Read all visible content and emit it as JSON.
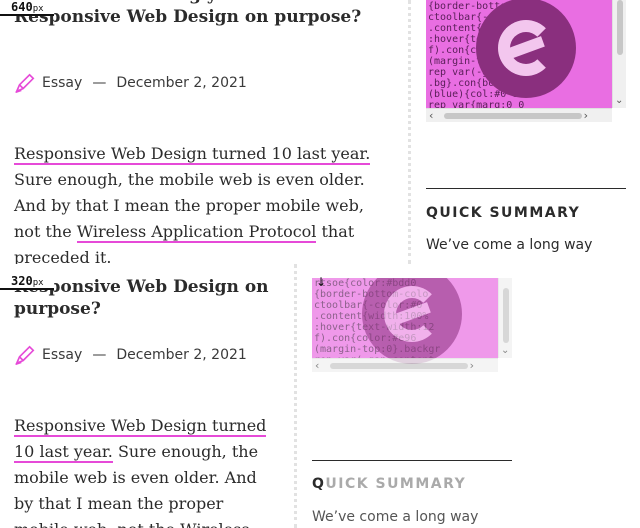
{
  "panels": {
    "wide": {
      "width_value": "640",
      "width_unit": "px",
      "article": {
        "title": "How about undoing years of Responsive Web Design on purpose?",
        "category": "Essay",
        "separator": "—",
        "date": "December 2, 2021",
        "link1": "Responsive Web Design turned 10 last year.",
        "text1": " Sure enough, the mobile web is even older. And by that I mean the proper mobile web, not the ",
        "link2": "Wireless Application Protocol",
        "text2": " that preceded it."
      },
      "sidebar": {
        "heading": "QUICK SUMMARY",
        "text": "We’ve come a long way"
      }
    },
    "narrow": {
      "width_value": "320",
      "width_unit": "px",
      "article": {
        "title": "Responsive Web Design on purpose?",
        "category": "Essay",
        "separator": "—",
        "date": "December 2, 2021",
        "link1": "Responsive Web Design turned 10 last year.",
        "text1": " Sure enough, the mobile web is even older. And by that I mean the proper mobile web, not the Wireless",
        "link2": "",
        "text2": ""
      },
      "sidebar": {
        "heading_first": "Q",
        "heading_rest": "UICK SUMMARY",
        "text": "We’ve come a long way"
      }
    }
  },
  "thumbnail": {
    "icon": "smashing-logo-icon",
    "code_text": "rtsoe{color:#bdd0\n{border-bottom-colo\nctoolbar{-color:#0\n.content{width:100%\n:hover{text-width:12\nf).con{color:#e96\n(margin-top:0}.backgr\nrep var(-gap-content\n.bg}.con{border:0.2}\n(blue){col:#0 8f\nrep var{marg:0 0\n(){content)-.00.25\n(content)margin-to"
  },
  "colors": {
    "link_underline": "#e64ad8",
    "thumb_bg": "#e96ee2",
    "logo": "#8a2f7e"
  }
}
